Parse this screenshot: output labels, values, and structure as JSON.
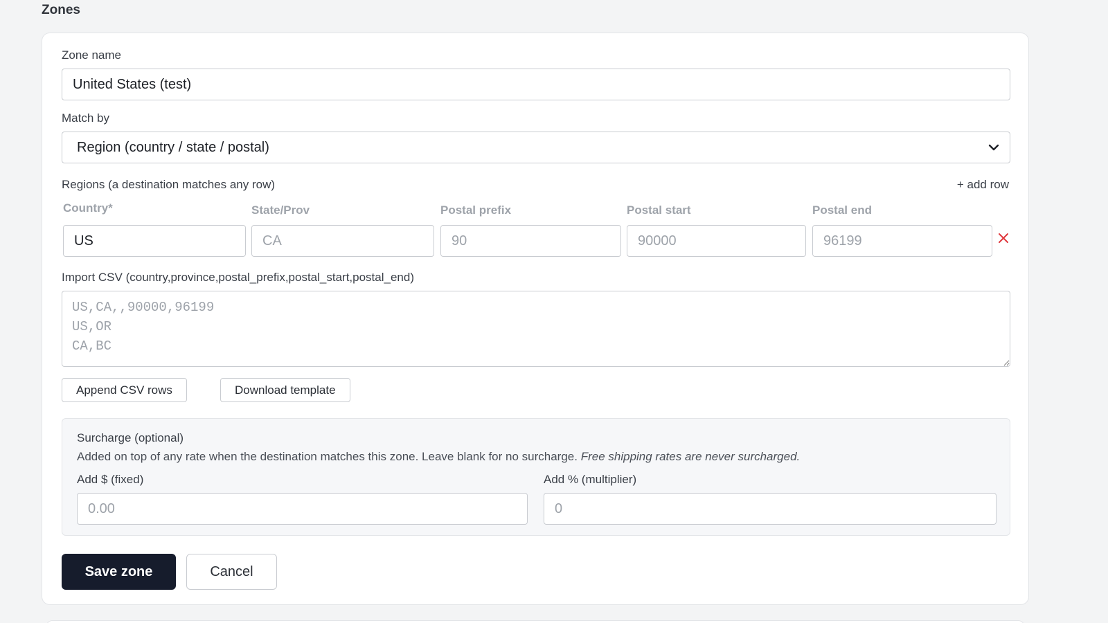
{
  "section": {
    "title": "Zones"
  },
  "zone_name": {
    "label": "Zone name",
    "value": "United States (test)"
  },
  "match_by": {
    "label": "Match by",
    "selected": "Region (country / state / postal)"
  },
  "regions": {
    "label": "Regions (a destination matches any row)",
    "add_row_label": "+ add row",
    "columns": {
      "country": "Country*",
      "state": "State/Prov",
      "postal_prefix": "Postal prefix",
      "postal_start": "Postal start",
      "postal_end": "Postal end"
    },
    "row": {
      "country_value": "US",
      "state_placeholder": "CA",
      "postal_prefix_placeholder": "90",
      "postal_start_placeholder": "90000",
      "postal_end_placeholder": "96199"
    }
  },
  "csv_import": {
    "label": "Import CSV (country,province,postal_prefix,postal_start,postal_end)",
    "placeholder": "US,CA,,90000,96199\nUS,OR\nCA,BC",
    "append_label": "Append CSV rows",
    "download_label": "Download template"
  },
  "surcharge": {
    "title": "Surcharge (optional)",
    "description": "Added on top of any rate when the destination matches this zone. Leave blank for no surcharge.",
    "description_italic": "Free shipping rates are never surcharged.",
    "fixed_label": "Add $ (fixed)",
    "fixed_placeholder": "0.00",
    "percent_label": "Add % (multiplier)",
    "percent_placeholder": "0"
  },
  "actions": {
    "save_label": "Save zone",
    "cancel_label": "Cancel"
  },
  "colors": {
    "primary": "#161c2c",
    "danger": "#e0393e",
    "muted": "#9ea3aa"
  },
  "icons": {
    "select": "chevron-down-icon",
    "remove": "close-icon"
  }
}
